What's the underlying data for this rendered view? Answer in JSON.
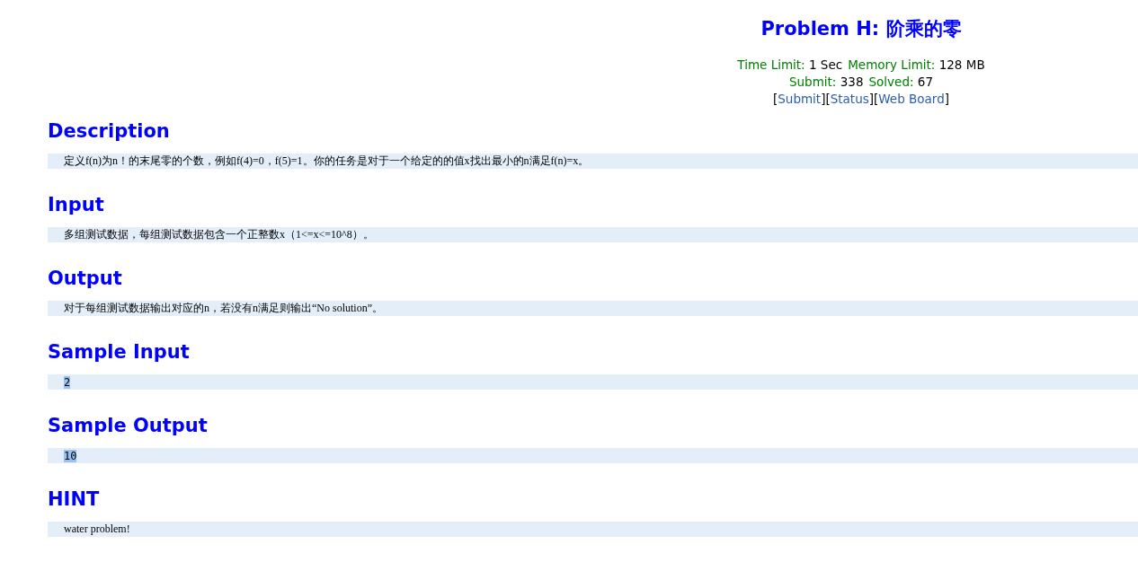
{
  "header": {
    "title": "Problem H: 阶乘的零",
    "limits": [
      {
        "label": "Time Limit:",
        "value": "1 Sec"
      },
      {
        "label": "Memory Limit:",
        "value": "128 MB"
      }
    ],
    "stats": [
      {
        "label": "Submit:",
        "value": "338"
      },
      {
        "label": "Solved:",
        "value": "67"
      }
    ],
    "links": [
      {
        "open": "[",
        "label": "Submit",
        "close": "]"
      },
      {
        "open": "[",
        "label": "Status",
        "close": "]"
      },
      {
        "open": "[",
        "label": "Web Board",
        "close": "]"
      }
    ]
  },
  "sections": [
    {
      "heading": "Description",
      "content": "定义f(n)为n！的末尾零的个数，例如f(4)=0，f(5)=1。你的任务是对于一个给定的的值x找出最小的n满足f(n)=x。",
      "kind": "text",
      "highlighted": false
    },
    {
      "heading": "Input",
      "content": "多组测试数据，每组测试数据包含一个正整数x（1<=x<=10^8）。",
      "kind": "text",
      "highlighted": false
    },
    {
      "heading": "Output",
      "content": "对于每组测试数据输出对应的n，若没有n满足则输出“No solution”。",
      "kind": "text",
      "highlighted": false
    },
    {
      "heading": "Sample Input",
      "content": "2",
      "kind": "sample",
      "highlighted": true
    },
    {
      "heading": "Sample Output",
      "content": "10",
      "kind": "sample",
      "highlighted": true
    },
    {
      "heading": "HINT",
      "content": "water problem!",
      "kind": "text",
      "highlighted": false
    }
  ]
}
